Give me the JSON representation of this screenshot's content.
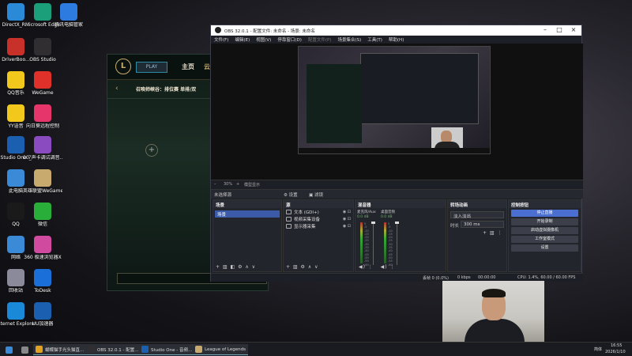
{
  "desktop_icons": [
    {
      "label": "DirectX_R...",
      "color": "#2a8ad8",
      "icon": "directx-icon"
    },
    {
      "label": "Microsoft Edge",
      "color": "#1a9f7a",
      "icon": "edge-icon"
    },
    {
      "label": "腾讯电脑管家",
      "color": "#2d7be0",
      "icon": "pc-manager-icon"
    },
    {
      "label": "DriverBoo...",
      "color": "#c8302a",
      "icon": "driverbooster-icon"
    },
    {
      "label": "OBS Studio",
      "color": "#302e31",
      "icon": "obs-icon"
    },
    {
      "label": "QQ音乐",
      "color": "#f2c81c",
      "icon": "qq-music-icon"
    },
    {
      "label": "WeGame",
      "color": "#e0302a",
      "icon": "wegame-icon"
    },
    {
      "label": "YY语音",
      "color": "#f2c81c",
      "icon": "yy-icon"
    },
    {
      "label": "向日葵远程控制",
      "color": "#e6356a",
      "icon": "sunflower-icon"
    },
    {
      "label": "Studio One 7",
      "color": "#1a5fb0",
      "icon": "studio-one-icon"
    },
    {
      "label": "00_声卡调试调音...",
      "color": "#8a4ac0",
      "icon": "archive-icon"
    },
    {
      "label": "此电脑",
      "color": "#3a8ad8",
      "icon": "this-pc-icon"
    },
    {
      "label": "英雄联盟WeGame版",
      "color": "#c8aa6e",
      "icon": "lol-icon"
    },
    {
      "label": "QQ",
      "color": "#1a1a1a",
      "icon": "qq-icon"
    },
    {
      "label": "微信",
      "color": "#2aae3a",
      "icon": "wechat-icon"
    },
    {
      "label": "网络",
      "color": "#3a8ad8",
      "icon": "network-icon"
    },
    {
      "label": "360 极速浏览器X",
      "color": "#d04aa0",
      "icon": "360-browser-icon"
    },
    {
      "label": "回收站",
      "color": "#8a8a9a",
      "icon": "recycle-bin-icon"
    },
    {
      "label": "ToDesk",
      "color": "#1a6fd8",
      "icon": "todesk-icon"
    },
    {
      "label": "Internet Explorer",
      "color": "#1a8ad8",
      "icon": "ie-icon"
    },
    {
      "label": "UU加速器",
      "color": "#1a5fb0",
      "icon": "uu-icon"
    }
  ],
  "lol": {
    "logo": "L",
    "play_label": "PLAY",
    "nav_home": "主页",
    "nav_tft": "云顶",
    "back": "‹",
    "mode": "召唤师峡谷：排位赛 单排/双",
    "plus": "+"
  },
  "obs": {
    "title": "OBS 32.0.1 - 配置文件: 未命名 - 场景: 未命名",
    "menu": [
      "文件(F)",
      "编辑(E)",
      "视图(V)",
      "停靠窗口(D)",
      "配置文件(P)",
      "场景集合(S)",
      "工具(T)",
      "帮助(H)"
    ],
    "zoom": "30%",
    "zoom_label": "模型显示",
    "no_source": "未选择源",
    "props_label": "⚙ 设置",
    "filters_label": "▣ 滤镜",
    "scenes_header": "场景",
    "scene_items": [
      "场景"
    ],
    "sources_header": "源",
    "sources": [
      "文本 (GDI+)",
      "视频采集设备",
      "显示器采集"
    ],
    "mixer_header": "混音器",
    "mixer_ch1": "麦克风/Aux",
    "mixer_ch2": "桌面音频",
    "mixer_db": "0.0 dB",
    "transitions_header": "转场动画",
    "transition_value": "淡入淡出",
    "duration_label": "时长",
    "duration_value": "300 ms",
    "controls_header": "控制按钮",
    "controls": [
      "停止直播",
      "开始录制",
      "启动虚拟摄像机",
      "工作室模式",
      "设置"
    ],
    "status_frames": "丢帧 0 (0.0%)",
    "status_kbps": "0 kbps",
    "status_live": "00:00:00",
    "status_cpu": "CPU: 1.4%, 60.00 / 60.00 FPS",
    "scale_ticks": [
      "5",
      "-5",
      "-10",
      "-15",
      "-20",
      "-25",
      "-30",
      "-35",
      "-40",
      "-45",
      "-50",
      "-55",
      "-60"
    ]
  },
  "taskbar": {
    "items": [
      {
        "label": "",
        "icon": "start-icon",
        "color": "#3a8ad8"
      },
      {
        "label": "",
        "icon": "search-icon",
        "color": "#888"
      },
      {
        "label": "蝴蝶猫手光头猫直...",
        "icon": "chrome-icon",
        "color": "#e0a020"
      },
      {
        "label": "OBS 32.0.1 - 配置...",
        "icon": "obs-icon",
        "color": "#302e31"
      },
      {
        "label": "Studio One - 音频...",
        "icon": "studio-one-icon",
        "color": "#1a5fb0"
      },
      {
        "label": "League of Legends",
        "icon": "lol-icon",
        "color": "#c8aa6e"
      }
    ],
    "clock_time": "16:55",
    "clock_date": "2026/1/10",
    "ime": "简体"
  }
}
